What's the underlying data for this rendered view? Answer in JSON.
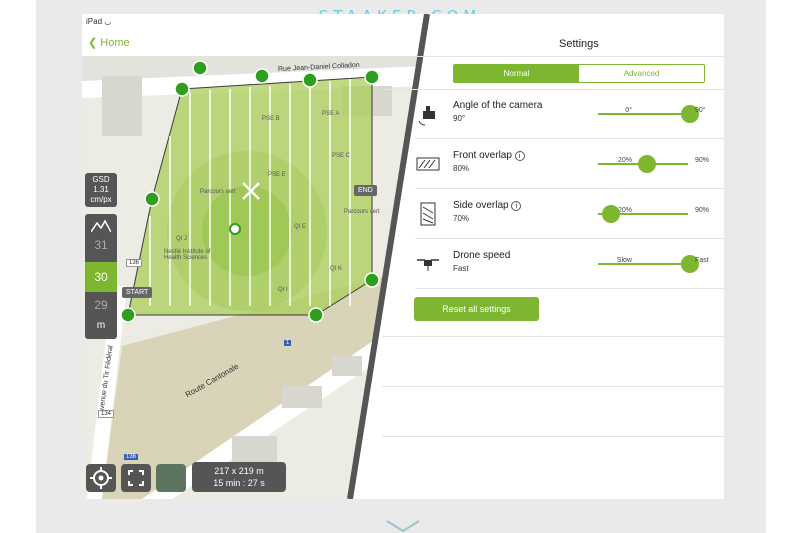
{
  "watermark": "STAAKER.COM",
  "status_bar": {
    "device": "iPad"
  },
  "nav": {
    "back_label": "Home"
  },
  "settings": {
    "title": "Settings",
    "tabs": [
      {
        "label": "Normal",
        "selected": true
      },
      {
        "label": "Advanced",
        "selected": false
      }
    ],
    "rows": [
      {
        "label": "Angle of the camera",
        "value": "90°",
        "min": "0°",
        "max": "90°",
        "level": 1.0,
        "icon": "camera-angle-icon"
      },
      {
        "label": "Front overlap",
        "value": "80%",
        "min": "20%",
        "max": "90%",
        "level": 0.85,
        "icon": "front-overlap-icon"
      },
      {
        "label": "Side overlap",
        "value": "70%",
        "min": "20%",
        "max": "90%",
        "level": 0.71,
        "icon": "side-overlap-icon"
      },
      {
        "label": "Drone speed",
        "value": "Fast",
        "min": "Slow",
        "max": "Fast",
        "level": 1.0,
        "icon": "drone-icon"
      }
    ],
    "reset_label": "Reset all settings"
  },
  "map": {
    "gsd_label": "GSD",
    "gsd_value": "1.31",
    "gsd_unit": "cm/px",
    "altitude": {
      "above": "31",
      "current": "30",
      "below": "29",
      "unit": "m"
    },
    "start_label": "START",
    "end_label": "END",
    "street_labels": [
      "Rue Jean-Daniel Colladon",
      "Route Cantonale",
      "Avenue du Tir Fédéral",
      "Parcours vert",
      "Parcours vert"
    ],
    "road_numbers": [
      "136",
      "1",
      "134",
      "136"
    ],
    "building_labels": [
      "PSE B",
      "PSE A",
      "PSE C",
      "PSE E",
      "QI E",
      "QI K",
      "QI J",
      "QI I"
    ],
    "poi_label": "Nestlé Institute of Health Sciences",
    "area": "217 x 219 m",
    "duration": "15 min : 27 s"
  },
  "colors": {
    "accent": "#7db72f",
    "panel_dark": "#555555",
    "map_bg": "#ecebe4"
  }
}
